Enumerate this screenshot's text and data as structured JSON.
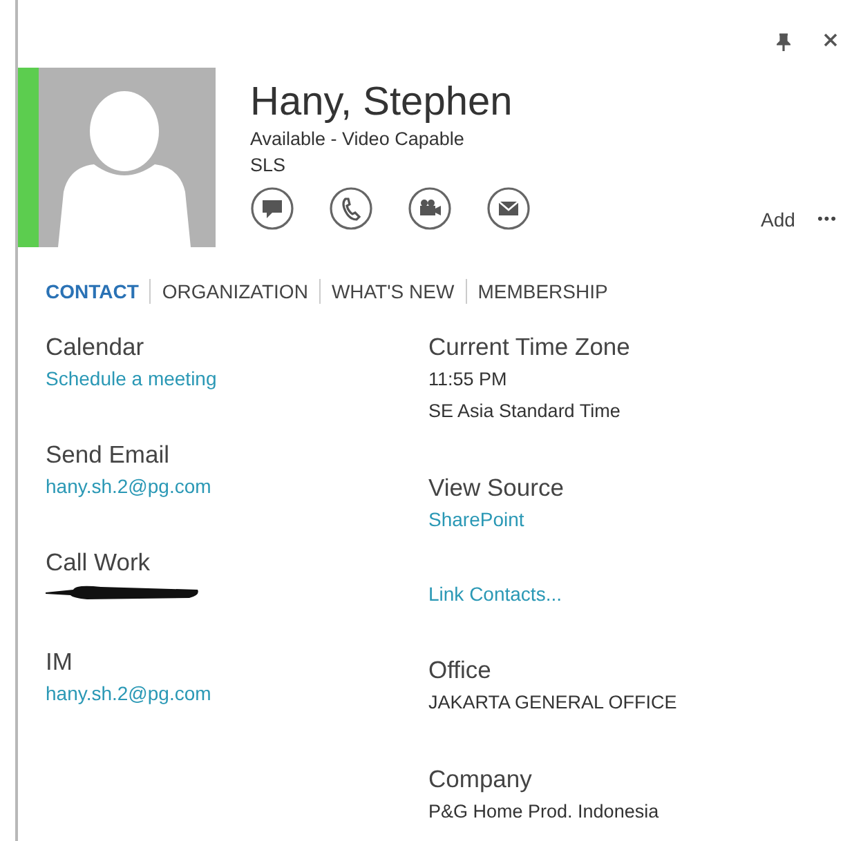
{
  "contact": {
    "name": "Hany, Stephen",
    "status": "Available - Video Capable",
    "department": "SLS",
    "available": true
  },
  "actions": [
    "Add",
    "•••"
  ],
  "tabs": [
    {
      "label": "CONTACT",
      "selected": true
    },
    {
      "label": "ORGANIZATION",
      "selected": false
    },
    {
      "label": "WHAT'S NEW",
      "selected": false
    },
    {
      "label": "MEMBERSHIP",
      "selected": false
    }
  ],
  "left_column": [
    {
      "label": "Calendar",
      "lines": [
        {
          "kind": "link",
          "text": "Schedule a meeting"
        }
      ]
    },
    {
      "label": "Send Email",
      "lines": [
        {
          "kind": "link",
          "text": "hany.sh.2@pg.com"
        }
      ]
    },
    {
      "label": "Call Work",
      "lines": [
        {
          "kind": "redacted"
        }
      ]
    },
    {
      "label": "IM",
      "lines": [
        {
          "kind": "link",
          "text": "hany.sh.2@pg.com"
        }
      ]
    }
  ],
  "right_column": [
    {
      "label": "Current Time Zone",
      "lines": [
        {
          "kind": "text",
          "text": "11:55 PM"
        },
        {
          "kind": "text",
          "text": "SE Asia Standard Time"
        }
      ]
    },
    {
      "label": "View Source",
      "lines": [
        {
          "kind": "link",
          "text": "SharePoint"
        }
      ]
    },
    {
      "lines": [
        {
          "kind": "link",
          "text": "Link Contacts..."
        }
      ]
    },
    {
      "label": "Office",
      "lines": [
        {
          "kind": "text",
          "text": "JAKARTA GENERAL OFFICE"
        }
      ]
    },
    {
      "label": "Company",
      "lines": [
        {
          "kind": "text",
          "text": "P&G Home Prod. Indonesia"
        }
      ]
    }
  ]
}
